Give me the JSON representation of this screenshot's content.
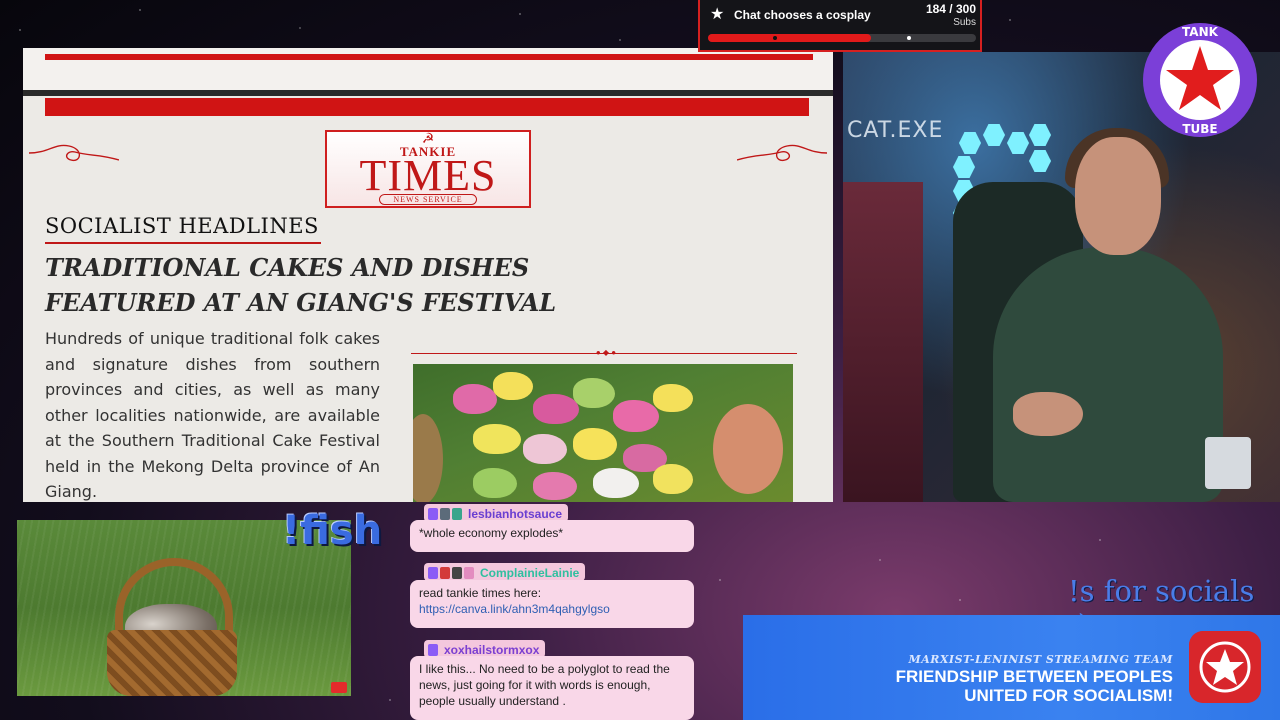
{
  "newspaper": {
    "brand_top": "TANKIE",
    "brand_main": "TIMES",
    "brand_sub": "NEWS SERVICE",
    "section": "SOCIALIST HEADLINES",
    "headline_line1": "TRADITIONAL CAKES AND DISHES",
    "headline_line2": "FEATURED AT AN GIANG'S FESTIVAL",
    "body": "Hundreds of unique traditional folk cakes and signature dishes from southern provinces and cities, as well as many other localities nationwide, are available at the Southern Traditional Cake Festival held in the Mekong Delta province of An Giang."
  },
  "webcam": {
    "label": "CAT.EXE"
  },
  "tank_tube": {
    "word_top": "TANK",
    "word_side": "TUBE"
  },
  "subgoal": {
    "title": "Chat chooses a cosplay",
    "count": "184 / 300",
    "unit": "Subs",
    "progress": 0.61,
    "marker_positions": [
      0.25,
      0.75
    ],
    "icon": "star-icon"
  },
  "overlay": {
    "fish_command": "!fish",
    "socials_text": "!s for socials :)"
  },
  "chat": [
    {
      "user": "lesbianhotsauce",
      "user_color": "#6a3fd1",
      "badges": [
        "#8b5cf6",
        "#5c6b7a",
        "#3aa58c"
      ],
      "text": "*whole economy explodes*"
    },
    {
      "user": "ComplainieLainie",
      "user_color": "#2fbf9f",
      "badges": [
        "#8b5cf6",
        "#d33a3a",
        "#444444",
        "#e38bbf"
      ],
      "text": "read tankie times here:",
      "link": "https://canva.link/ahn3m4qahgylgso"
    },
    {
      "user": "xoxhailstormxox",
      "user_color": "#7b3fd1",
      "badges": [
        "#8b5cf6"
      ],
      "text": "I like this... No need to be a polyglot to read the news, just going for it with words is enough, people usually understand ."
    }
  ],
  "banner": {
    "subtitle": "MARXIST-LENINIST STREAMING TEAM",
    "line1": "FRIENDSHIP BETWEEN PEOPLES",
    "line2": "UNITED FOR SOCIALISM!"
  },
  "colors": {
    "accent_red": "#d01414",
    "banner_blue": "#2f77e8",
    "chat_bubble": "#f9d7e8"
  }
}
